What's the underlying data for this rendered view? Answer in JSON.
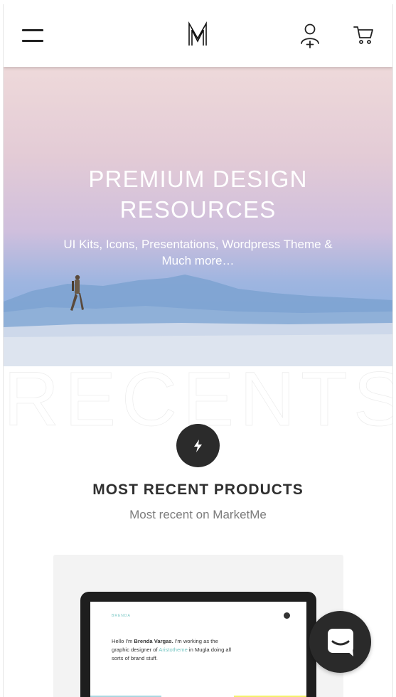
{
  "header": {
    "menu_icon": "hamburger-menu-icon",
    "logo_icon": "marketme-m-logo",
    "user_icon": "user-add-icon",
    "cart_icon": "shopping-cart-icon"
  },
  "hero": {
    "title": "PREMIUM DESIGN\nRESOURCES",
    "subtitle": "UI Kits, Icons, Presentations, Wordpress Theme & Much more…"
  },
  "recents": {
    "watermark": "RECENTS",
    "badge_icon": "lightning-bolt-icon",
    "title": "MOST RECENT PRODUCTS",
    "subtitle": "Most recent on MarketMe"
  },
  "product_preview": {
    "brand": "BRENDA",
    "intro_prefix": "Hello I'm ",
    "intro_name": "Brenda Vargas.",
    "intro_middle": " I'm working as the graphic designer of ",
    "intro_company": "Aristotheme",
    "intro_suffix": " in Mugla doing all sorts of brand stuff."
  },
  "chat": {
    "icon": "chat-messenger-icon"
  },
  "colors": {
    "dark": "#2b2b2b",
    "accent_teal": "#79c7c4",
    "block_blue": "#a9d7e0",
    "block_yellow": "#f4f06a"
  }
}
